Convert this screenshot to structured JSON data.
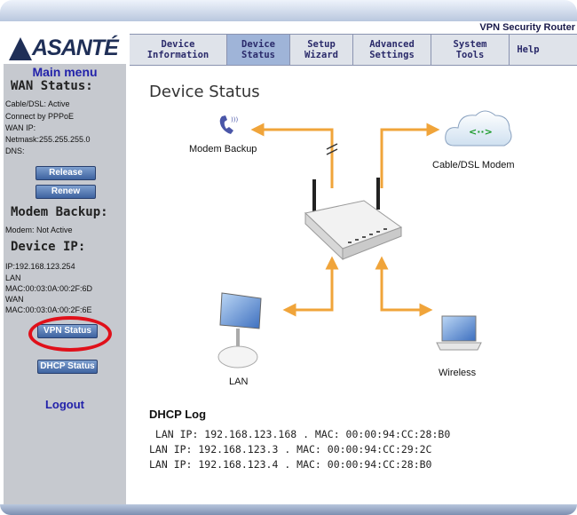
{
  "header": {
    "router_title": "VPN Security Router",
    "logo_text": "ASANTÉ"
  },
  "nav": {
    "tabs": [
      {
        "line1": "Device",
        "line2": "Information"
      },
      {
        "line1": "Device",
        "line2": "Status"
      },
      {
        "line1": "Setup",
        "line2": "Wizard"
      },
      {
        "line1": "Advanced",
        "line2": "Settings"
      },
      {
        "line1": "System",
        "line2": "Tools"
      },
      {
        "line1": "Help",
        "line2": ""
      }
    ],
    "active_index": 1
  },
  "sidebar": {
    "main_menu": "Main menu",
    "wan_status_heading": "WAN Status:",
    "cable_dsl": "Cable/DSL: Active",
    "connect_by": "Connect by PPPoE",
    "wan_ip": "WAN IP:",
    "netmask": "Netmask:255.255.255.0",
    "dns": "DNS:",
    "release_button": "Release",
    "renew_button": "Renew",
    "modem_backup_heading": "Modem Backup:",
    "modem_status": "Modem: Not Active",
    "device_ip_heading": "Device IP:",
    "ip": "IP:192.168.123.254",
    "lan_label": "LAN",
    "lan_mac": "MAC:00:03:0A:00:2F:6D",
    "wan_label": "WAN",
    "wan_mac": "MAC:00:03:0A:00:2F:6E",
    "vpn_status_button": "VPN Status",
    "dhcp_status_button": "DHCP Status",
    "logout": "Logout"
  },
  "main": {
    "title": "Device Status",
    "diagram": {
      "modem_backup_label": "Modem Backup",
      "cable_modem_label": "Cable/DSL Modem",
      "lan_label": "LAN",
      "wireless_label": "Wireless"
    },
    "dhcp_log_title": "DHCP Log",
    "dhcp_log": [
      " LAN IP: 192.168.123.168 . MAC: 00:00:94:CC:28:B0",
      "LAN IP: 192.168.123.3 . MAC: 00:00:94:CC:29:2C",
      "LAN IP: 192.168.123.4 . MAC: 00:00:94:CC:28:B0"
    ]
  },
  "colors": {
    "accent_blue": "#2222aa",
    "arrow_orange": "#f0a43a",
    "highlight_red": "#e0101a",
    "sidebar_gray": "#c6c9cf"
  }
}
